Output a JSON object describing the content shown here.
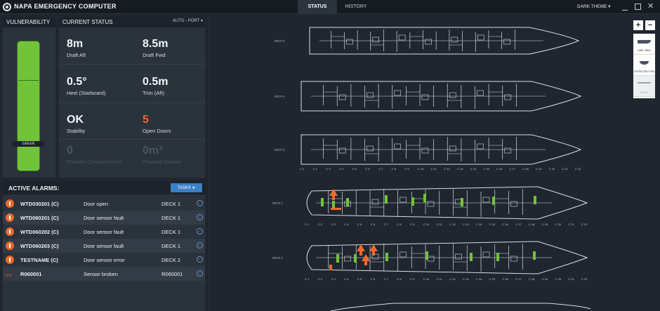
{
  "app": {
    "title": "NAPA EMERGENCY COMPUTER"
  },
  "tabs": [
    {
      "label": "STATUS",
      "active": true
    },
    {
      "label": "HISTORY",
      "active": false
    }
  ],
  "theme": {
    "label": "DARK THEME ▾"
  },
  "window_controls": {
    "close": "✕"
  },
  "vulnerability": {
    "title": "VULNERABILITY",
    "level": "GREEN",
    "color": "#71c43a"
  },
  "current_status": {
    "title": "CURRENT STATUS",
    "mode": "AUTO - PORT ▾",
    "metrics": [
      {
        "value": "8m",
        "label": "Draft Aft"
      },
      {
        "value": "8.5m",
        "label": "Draft Fwd"
      },
      {
        "value": "0.5°",
        "label": "Heel (Starboard)"
      },
      {
        "value": "0.5m",
        "label": "Trim (Aft)"
      },
      {
        "value": "OK",
        "label": "Stability"
      },
      {
        "value": "5",
        "label": "Open Doors"
      },
      {
        "value": "0",
        "label": "Flooded Compartments"
      },
      {
        "value": "0m³",
        "label": "Flooded Volume"
      }
    ]
  },
  "alarms": {
    "title": "ACTIVE ALARMS:",
    "tasks_label": "TASKS ➤",
    "rows": [
      {
        "id": "WTD030201  (C)",
        "desc": "Door open",
        "loc": "DECK 1",
        "icon": "warning-badge"
      },
      {
        "id": "WTD060201  (C)",
        "desc": "Door sensor fault",
        "loc": "DECK 1",
        "icon": "warning-badge"
      },
      {
        "id": "WTD060202  (C)",
        "desc": "Door sensor fault",
        "loc": "DECK 1",
        "icon": "warning-badge"
      },
      {
        "id": "WTD060203  (C)",
        "desc": "Door sensor fault",
        "loc": "DECK 1",
        "icon": "warning-badge"
      },
      {
        "id": "TESTNAME  (C)",
        "desc": "Door sensor error",
        "loc": "DECK 2",
        "icon": "warning-badge"
      },
      {
        "id": "R060001",
        "desc": "Sensor broken",
        "loc": "R060001",
        "icon": "sensor-wave"
      }
    ]
  },
  "ship": {
    "decks": [
      {
        "label": "DECK 5"
      },
      {
        "label": "DECK 4"
      },
      {
        "label": "DECK 3"
      },
      {
        "label": "DECK 2"
      },
      {
        "label": "DECK 1"
      }
    ],
    "frame_labels": [
      "C 1",
      "C 2",
      "C 3",
      "C 4",
      "C 5",
      "C 6",
      "C 7",
      "C 8",
      "C 9",
      "C 10",
      "C 11",
      "C 12",
      "C 13",
      "C 14",
      "C 15",
      "C 16",
      "C 17",
      "C 18",
      "C 19",
      "C 20",
      "C 21",
      "C 22"
    ]
  },
  "toolbar": {
    "zoom_in": "+",
    "zoom_out": "−",
    "views": [
      {
        "label": "SIDE VIEW",
        "enabled": true
      },
      {
        "label": "CROSS-SECTION",
        "enabled": true
      },
      {
        "label": "DECKS",
        "enabled": false
      }
    ]
  },
  "colors": {
    "accent": "#3b7fc4",
    "alarm": "#ee6a2c",
    "door_ok": "#71c43a"
  }
}
